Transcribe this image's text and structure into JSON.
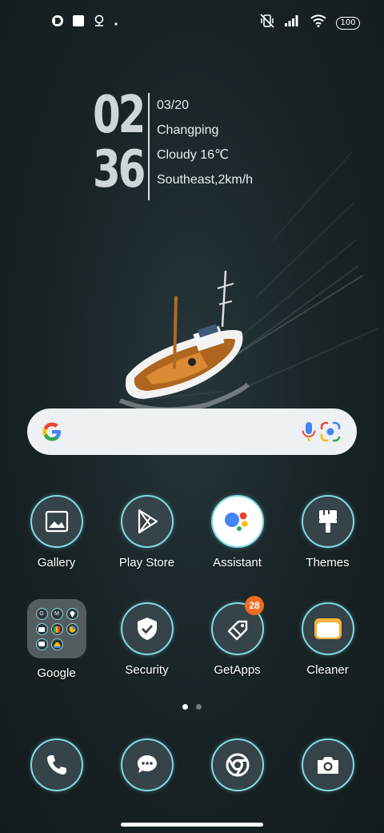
{
  "status_bar": {
    "left_icons": [
      "app-notification-icon",
      "square-notification-icon",
      "location-notification-icon",
      "dot-icon"
    ],
    "right_icons": [
      "vibrate-icon",
      "signal-icon",
      "wifi-icon"
    ],
    "battery": "100"
  },
  "clock_widget": {
    "hour": "02",
    "minute": "36",
    "date": "03/20",
    "location": "Changping",
    "weather": "Cloudy 16℃",
    "wind": "Southeast,2km/h"
  },
  "search_bar": {
    "icons": [
      "google-logo-icon",
      "microphone-icon",
      "google-lens-icon"
    ]
  },
  "apps_row1": [
    {
      "label": "Gallery",
      "icon": "gallery-icon"
    },
    {
      "label": "Play Store",
      "icon": "play-store-icon"
    },
    {
      "label": "Assistant",
      "icon": "assistant-icon"
    },
    {
      "label": "Themes",
      "icon": "paint-brush-icon"
    }
  ],
  "apps_row2": [
    {
      "label": "Google",
      "icon": "folder-icon"
    },
    {
      "label": "Security",
      "icon": "shield-check-icon"
    },
    {
      "label": "GetApps",
      "icon": "getapps-tag-icon",
      "badge": "28"
    },
    {
      "label": "Cleaner",
      "icon": "cleaner-icon"
    }
  ],
  "google_folder": {
    "mini_icons": [
      "G",
      "M",
      "maps-pin",
      "youtube",
      "pay",
      "photos",
      "messages",
      "drive"
    ]
  },
  "pages": {
    "count": 2,
    "current": 1
  },
  "dock": [
    "phone-icon",
    "messages-icon",
    "chrome-icon",
    "camera-icon"
  ],
  "colors": {
    "icon_ring": "#7fdbe1",
    "icon_fill": "#364348",
    "badge": "#f26a21",
    "wallpaper": "#1a2528"
  }
}
